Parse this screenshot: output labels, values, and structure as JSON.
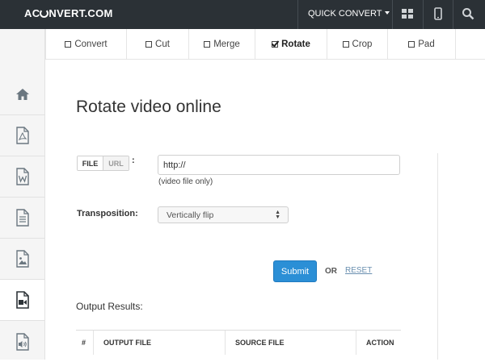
{
  "header": {
    "logo_text_a": "AC",
    "logo_text_b": "NVERT.COM",
    "quick_convert": "QUICK CONVERT",
    "icons": [
      "grid-icon",
      "mobile-icon",
      "search-icon"
    ]
  },
  "sidebar": {
    "items": [
      {
        "icon": "home-icon"
      },
      {
        "icon": "pdf-icon"
      },
      {
        "icon": "word-icon"
      },
      {
        "icon": "document-icon"
      },
      {
        "icon": "image-icon"
      },
      {
        "icon": "video-icon",
        "active": true
      },
      {
        "icon": "audio-icon"
      }
    ]
  },
  "tabs": [
    {
      "label": "Convert"
    },
    {
      "label": "Cut"
    },
    {
      "label": "Merge"
    },
    {
      "label": "Rotate",
      "active": true
    },
    {
      "label": "Crop"
    },
    {
      "label": "Pad"
    }
  ],
  "main": {
    "title": "Rotate video online",
    "source_toggle": {
      "file": "FILE",
      "url": "URL"
    },
    "colon": ":",
    "url_value": "http://",
    "hint": "(video file only)",
    "transposition_label": "Transposition:",
    "transposition_value": "Vertically flip",
    "submit_label": "Submit",
    "or_label": "OR",
    "reset_label": "RESET",
    "output_label": "Output Results:",
    "table_headers": [
      "#",
      "OUTPUT FILE",
      "SOURCE FILE",
      "ACTION"
    ]
  },
  "colors": {
    "topbar": "#2b3136",
    "accent": "#2b8fd6",
    "link": "#6a8fb0"
  }
}
